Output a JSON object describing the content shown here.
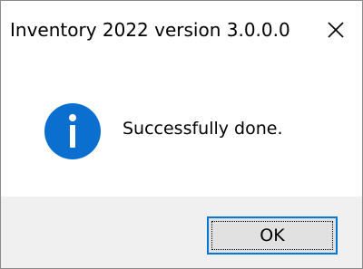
{
  "window": {
    "title": "Inventory 2022 version 3.0.0.0",
    "close_icon": "close-icon"
  },
  "message": {
    "icon": "information-icon",
    "icon_color": "#0a6fcf",
    "text": "Successfully done."
  },
  "buttons": {
    "ok_label": "OK",
    "focus_color": "#0078d7"
  }
}
